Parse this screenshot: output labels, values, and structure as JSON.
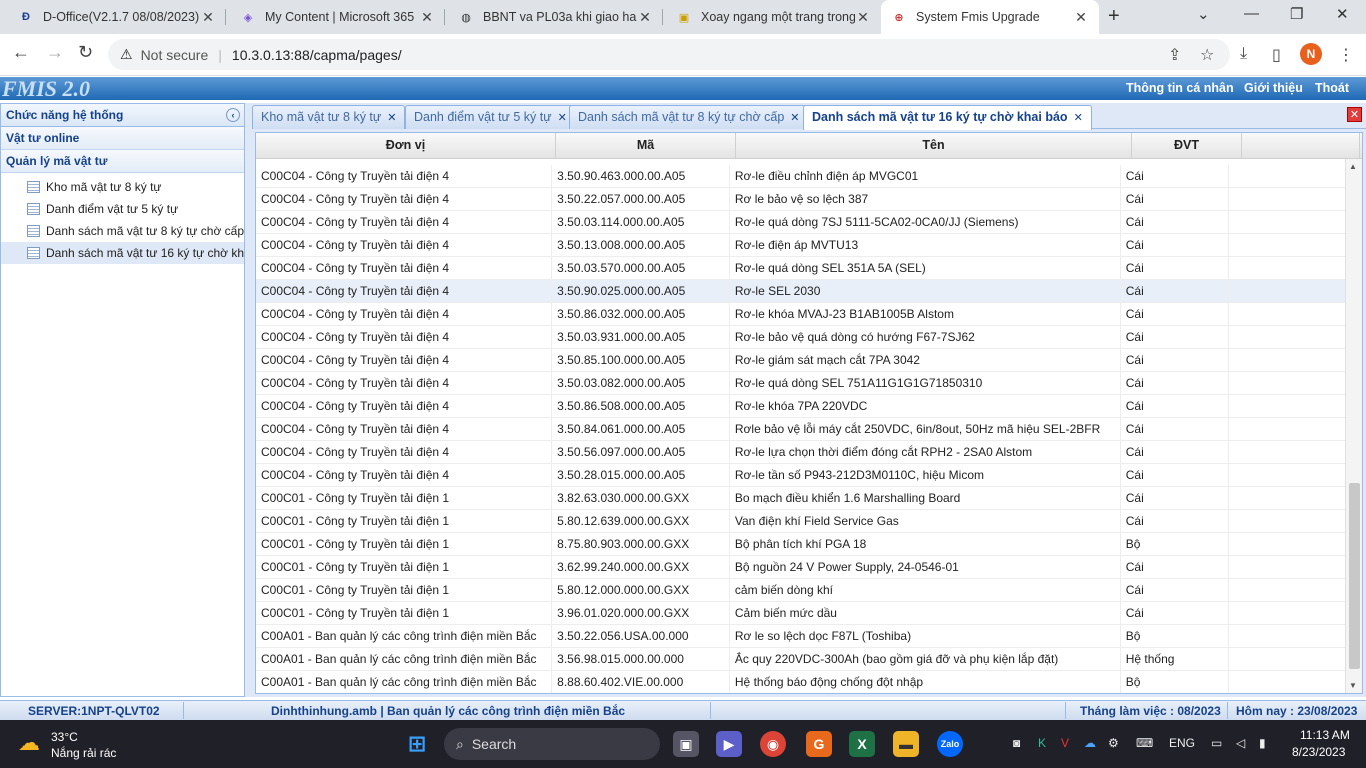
{
  "browser": {
    "tabs": [
      {
        "title": "D-Office(V2.1.7 08/08/2023)",
        "icon": "d-office-icon"
      },
      {
        "title": "My Content | Microsoft 365",
        "icon": "microsoft365-icon"
      },
      {
        "title": "BBNT va PL03a khi giao hang",
        "icon": "globe-icon"
      },
      {
        "title": "Xoay ngang một trang trong",
        "icon": "document-icon"
      },
      {
        "title": "System Fmis Upgrade",
        "icon": "fmis-icon"
      }
    ],
    "new_tab_label": "+",
    "address": {
      "security": "Not secure",
      "url": "10.3.0.13:88/capma/pages/"
    },
    "profile_initial": "N"
  },
  "app": {
    "logo": "FMIS 2.0",
    "header_links": [
      "Thông tin cá nhân",
      "Giới thiệu",
      "Thoát"
    ]
  },
  "sidebar": {
    "title": "Chức năng hệ thống",
    "sections": [
      "Vật tư online",
      "Quản lý mã vật tư"
    ],
    "items": [
      "Kho mã vật tư 8 ký tự",
      "Danh điểm vật tư 5 ký tự",
      "Danh sách mã vật tư 8 ký tự chờ cấp",
      "Danh sách mã vật tư 16 ký tự chờ khai báo"
    ],
    "selected_index": 3
  },
  "content_tabs": [
    "Kho mã vật tư 8 ký tự",
    "Danh điểm vật tư 5 ký tự",
    "Danh sách mã vật tư 8 ký tự chờ cấp",
    "Danh sách mã vật tư 16 ký tự chờ khai báo"
  ],
  "active_content_tab": 3,
  "grid": {
    "columns": [
      "Đơn vị",
      "Mã",
      "Tên",
      "ĐVT",
      ""
    ],
    "highlight_row": 5,
    "rows": [
      [
        "C00C04 - Công ty Truyền tải điện 4",
        "3.50.90.463.000.00.A05",
        "Rơ-le điều chỉnh điện áp MVGC01",
        "Cái"
      ],
      [
        "C00C04 - Công ty Truyền tải điện 4",
        "3.50.22.057.000.00.A05",
        "Rơ le bảo vệ so lệch 387",
        "Cái"
      ],
      [
        "C00C04 - Công ty Truyền tải điện 4",
        "3.50.03.114.000.00.A05",
        "Rơ-le quá dòng 7SJ 5111-5CA02-0CA0/JJ (Siemens)",
        "Cái"
      ],
      [
        "C00C04 - Công ty Truyền tải điện 4",
        "3.50.13.008.000.00.A05",
        "Rơ-le điện áp MVTU13",
        "Cái"
      ],
      [
        "C00C04 - Công ty Truyền tải điện 4",
        "3.50.03.570.000.00.A05",
        "Rơ-le quá dòng SEL 351A 5A (SEL)",
        "Cái"
      ],
      [
        "C00C04 - Công ty Truyền tải điện 4",
        "3.50.90.025.000.00.A05",
        "Rơ-le SEL 2030",
        "Cái"
      ],
      [
        "C00C04 - Công ty Truyền tải điện 4",
        "3.50.86.032.000.00.A05",
        "Rơ-le khóa MVAJ-23 B1AB1005B Alstom",
        "Cái"
      ],
      [
        "C00C04 - Công ty Truyền tải điện 4",
        "3.50.03.931.000.00.A05",
        "Rơ-le bảo vệ quá dòng có hướng F67-7SJ62",
        "Cái"
      ],
      [
        "C00C04 - Công ty Truyền tải điện 4",
        "3.50.85.100.000.00.A05",
        "Rơ-le giám sát mạch cắt 7PA 3042",
        "Cái"
      ],
      [
        "C00C04 - Công ty Truyền tải điện 4",
        "3.50.03.082.000.00.A05",
        "Rơ-le quá dòng SEL 751A11G1G1G71850310",
        "Cái"
      ],
      [
        "C00C04 - Công ty Truyền tải điện 4",
        "3.50.86.508.000.00.A05",
        "Rơ-le khóa 7PA 220VDC",
        "Cái"
      ],
      [
        "C00C04 - Công ty Truyền tải điện 4",
        "3.50.84.061.000.00.A05",
        "Rơle bảo vệ lỗi máy cắt 250VDC, 6in/8out, 50Hz mã hiệu SEL-2BFR",
        "Cái"
      ],
      [
        "C00C04 - Công ty Truyền tải điện 4",
        "3.50.56.097.000.00.A05",
        "Rơ-le lựa chọn thời điểm đóng cắt RPH2 - 2SA0 Alstom",
        "Cái"
      ],
      [
        "C00C04 - Công ty Truyền tải điện 4",
        "3.50.28.015.000.00.A05",
        "Rơ-le tần số P943-212D3M0110C, hiệu Micom",
        "Cái"
      ],
      [
        "C00C01 - Công ty Truyền tải điện 1",
        "3.82.63.030.000.00.GXX",
        "Bo mạch điều khiển 1.6 Marshalling Board",
        "Cái"
      ],
      [
        "C00C01 - Công ty Truyền tải điện 1",
        "5.80.12.639.000.00.GXX",
        "Van điện khí Field Service Gas",
        "Cái"
      ],
      [
        "C00C01 - Công ty Truyền tải điện 1",
        "8.75.80.903.000.00.GXX",
        "Bộ phân tích khí PGA 18",
        "Bộ"
      ],
      [
        "C00C01 - Công ty Truyền tải điện 1",
        "3.62.99.240.000.00.GXX",
        "Bộ nguồn 24 V Power Supply, 24-0546-01",
        "Cái"
      ],
      [
        "C00C01 - Công ty Truyền tải điện 1",
        "5.80.12.000.000.00.GXX",
        "cảm biến dòng khí",
        "Cái"
      ],
      [
        "C00C01 - Công ty Truyền tải điện 1",
        "3.96.01.020.000.00.GXX",
        "Cảm biến mức dầu",
        "Cái"
      ],
      [
        "C00A01 - Ban quản lý các công trình điện miền Bắc",
        "3.50.22.056.USA.00.000",
        "Rơ le so lệch dọc F87L (Toshiba)",
        "Bộ"
      ],
      [
        "C00A01 - Ban quản lý các công trình điện miền Bắc",
        "3.56.98.015.000.00.000",
        "Ắc quy 220VDC-300Ah (bao gồm giá đỡ và phụ kiện lắp đặt)",
        "Hệ thống"
      ],
      [
        "C00A01 - Ban quản lý các công trình điện miền Bắc",
        "8.88.60.402.VIE.00.000",
        "Hệ thống báo động chống đột nhập",
        "Bộ"
      ]
    ]
  },
  "status": {
    "server": "SERVER:1NPT-QLVT02",
    "user": "Dinhthinhung.amb | Ban quản lý các công trình điện miền Bắc",
    "work_month": "Tháng làm việc : 08/2023",
    "today": "Hôm nay : 23/08/2023"
  },
  "taskbar": {
    "weather_temp": "33°C",
    "weather_desc": "Nắng rải rác",
    "search": "Search",
    "lang": "ENG",
    "time": "11:13 AM",
    "date": "8/23/2023"
  },
  "colors": {
    "header_blue": "#1f69b4",
    "panel_border": "#99bbe8",
    "title_blue": "#15428b"
  }
}
